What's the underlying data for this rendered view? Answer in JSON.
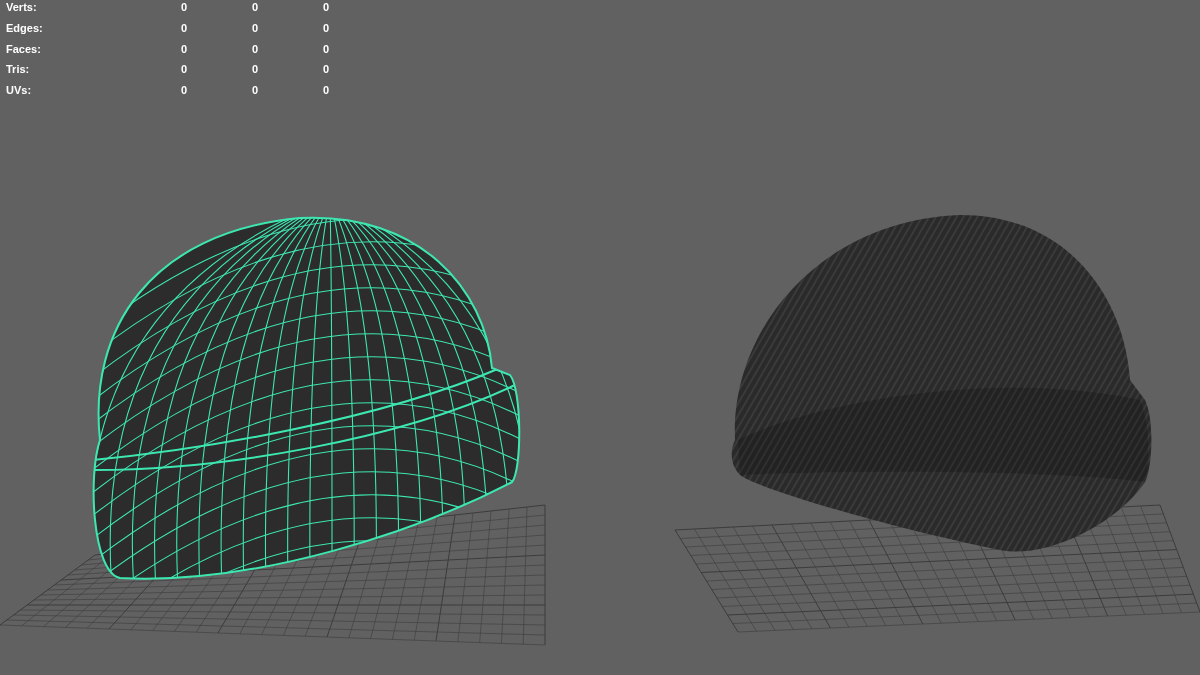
{
  "hud": {
    "rows": [
      {
        "label": "Verts:",
        "values": [
          "0",
          "0",
          "0"
        ]
      },
      {
        "label": "Edges:",
        "values": [
          "0",
          "0",
          "0"
        ]
      },
      {
        "label": "Faces:",
        "values": [
          "0",
          "0",
          "0"
        ]
      },
      {
        "label": "Tris:",
        "values": [
          "0",
          "0",
          "0"
        ]
      },
      {
        "label": "UVs:",
        "values": [
          "0",
          "0",
          "0"
        ]
      }
    ]
  }
}
